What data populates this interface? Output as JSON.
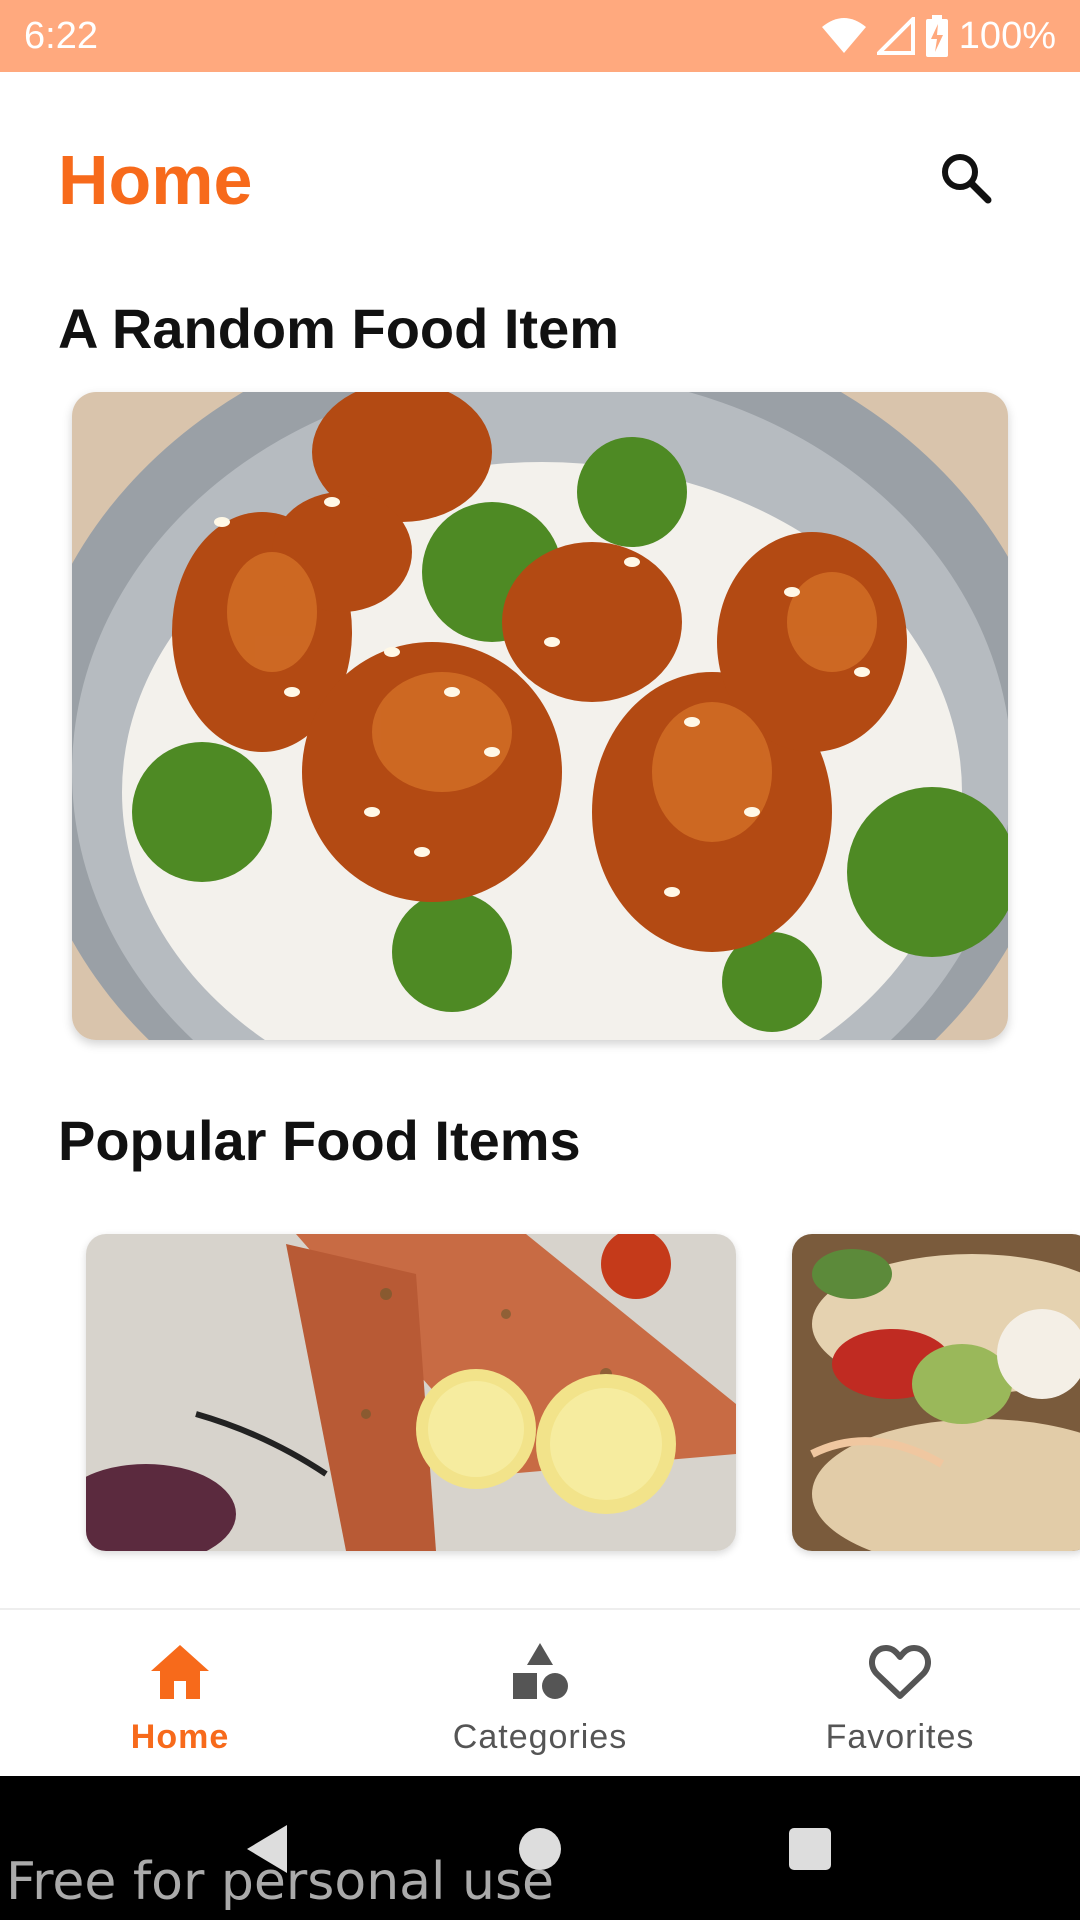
{
  "status_bar": {
    "time": "6:22",
    "battery": "100%",
    "icons": [
      "wifi-icon",
      "signal-icon",
      "battery-charging-icon"
    ]
  },
  "header": {
    "title": "Home",
    "search_icon": "search-icon"
  },
  "sections": {
    "random": {
      "title": "A Random Food Item"
    },
    "popular": {
      "title": "Popular Food Items"
    }
  },
  "bottom_nav": {
    "items": [
      {
        "label": "Home",
        "icon": "home-icon",
        "active": true
      },
      {
        "label": "Categories",
        "icon": "categories-icon",
        "active": false
      },
      {
        "label": "Favorites",
        "icon": "heart-icon",
        "active": false
      }
    ]
  },
  "system_nav": {
    "icons": [
      "back-icon",
      "home-circle-icon",
      "recents-icon"
    ]
  },
  "watermark": "Free for personal use",
  "colors": {
    "accent": "#F76A1B",
    "status_bar": "#FFA97E",
    "nav_inactive": "#555555"
  }
}
